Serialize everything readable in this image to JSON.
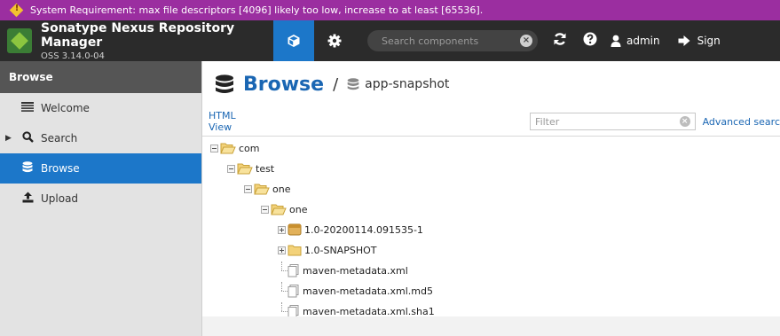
{
  "banner": {
    "text": "System Requirement: max file descriptors [4096] likely too low, increase to at least [65536]."
  },
  "header": {
    "app_title": "Sonatype Nexus Repository Manager",
    "version": "OSS 3.14.0-04",
    "search_placeholder": "Search components",
    "user": "admin",
    "signout": "Sign"
  },
  "sidebar": {
    "heading": "Browse",
    "items": [
      {
        "label": "Welcome",
        "icon": "list-icon"
      },
      {
        "label": "Search",
        "icon": "search-icon"
      },
      {
        "label": "Browse",
        "icon": "database-icon",
        "active": true
      },
      {
        "label": "Upload",
        "icon": "upload-icon"
      }
    ]
  },
  "main": {
    "title": "Browse",
    "separator": "/",
    "repository": "app-snapshot",
    "html_view": "HTML View",
    "filter_placeholder": "Filter",
    "advanced_search": "Advanced searc"
  },
  "tree": [
    {
      "label": "com",
      "type": "folder"
    },
    {
      "label": "test",
      "type": "folder"
    },
    {
      "label": "one",
      "type": "folder"
    },
    {
      "label": "one",
      "type": "folder"
    },
    {
      "label": "1.0-20200114.091535-1",
      "type": "component"
    },
    {
      "label": "1.0-SNAPSHOT",
      "type": "folder"
    },
    {
      "label": "maven-metadata.xml",
      "type": "file"
    },
    {
      "label": "maven-metadata.xml.md5",
      "type": "file"
    },
    {
      "label": "maven-metadata.xml.sha1",
      "type": "file"
    }
  ],
  "colors": {
    "banner": "#9b2ea0",
    "header": "#2b2b2b",
    "accent": "#1c77c9",
    "link": "#1a66b3"
  }
}
